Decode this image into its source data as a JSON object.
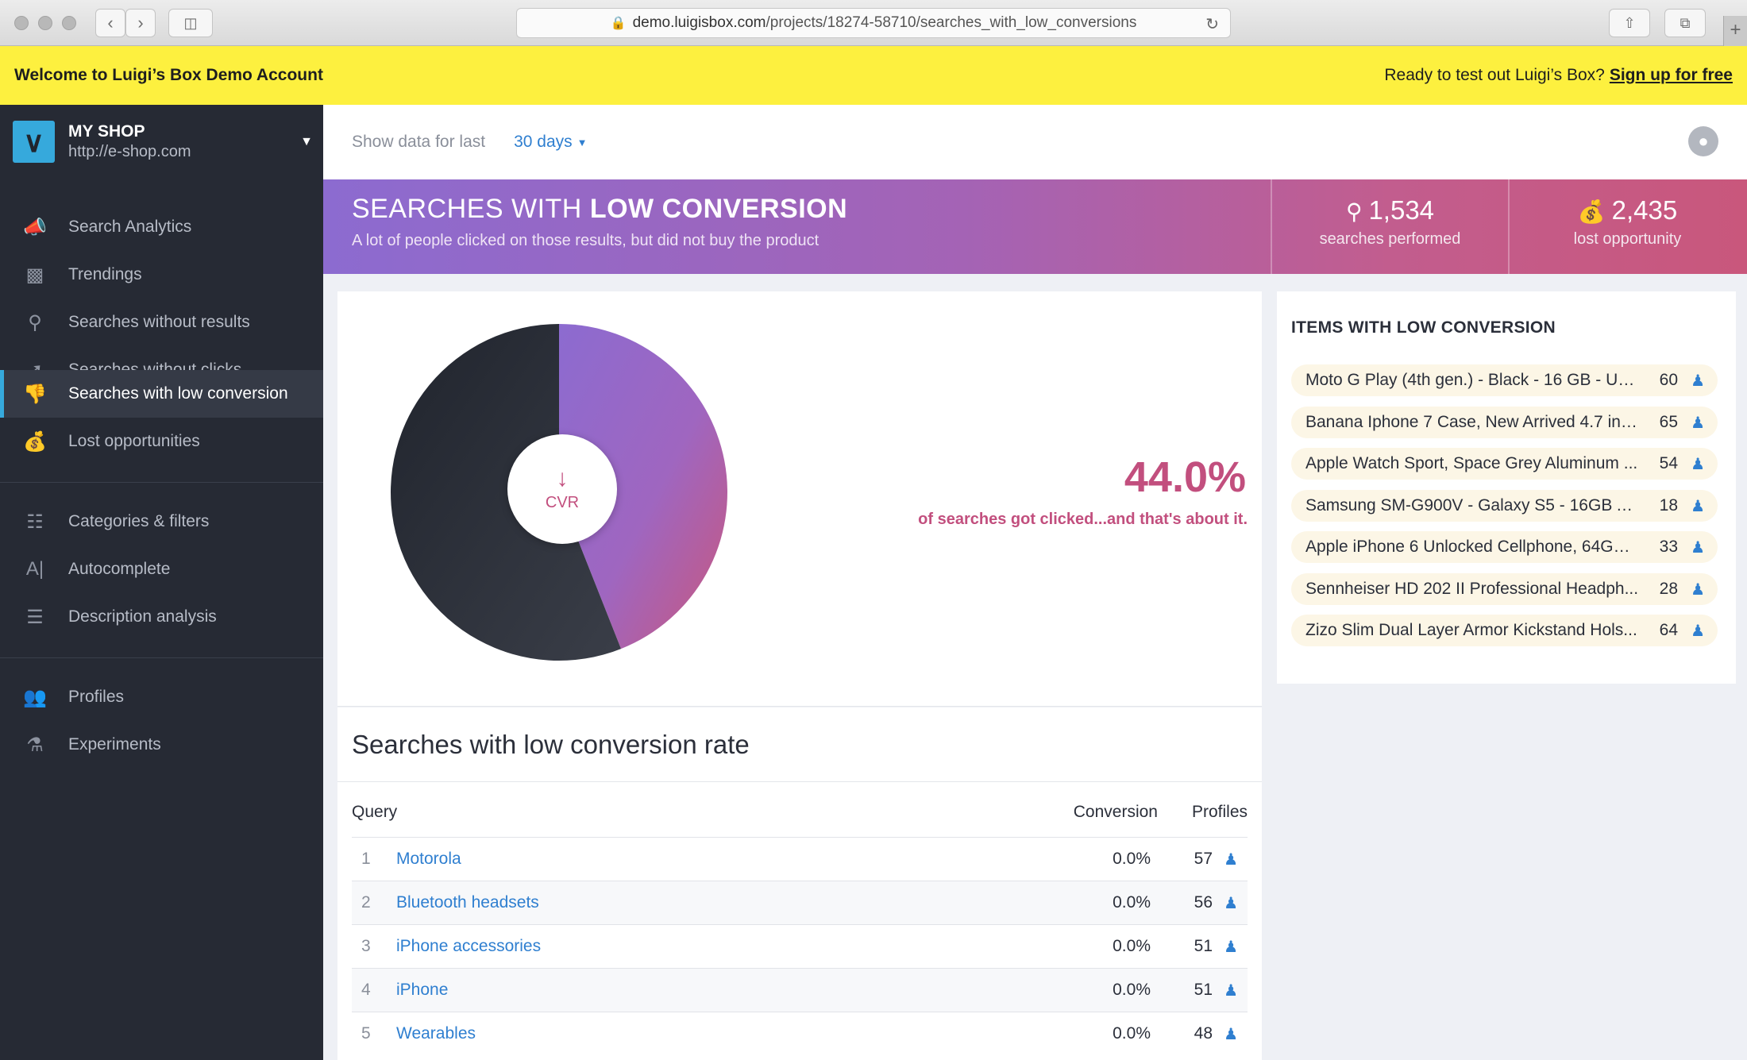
{
  "browser": {
    "url_host": "demo.luigisbox.com",
    "url_path": "/projects/18274-58710/searches_with_low_conversions"
  },
  "banner": {
    "welcome": "Welcome to Luigi’s Box Demo Account",
    "cta_prefix": "Ready to test out Luigi’s Box?",
    "cta_link": "Sign up for free"
  },
  "shop": {
    "name": "MY SHOP",
    "url": "http://e-shop.com"
  },
  "sidebar": {
    "items": [
      {
        "label": "Search Analytics",
        "icon": "megaphone-icon"
      },
      {
        "label": "Trendings",
        "icon": "bar-chart-icon"
      },
      {
        "label": "Searches without results",
        "icon": "search-x-icon"
      },
      {
        "label": "Searches without clicks",
        "icon": "cursor-icon"
      },
      {
        "label": "Searches with low conversion",
        "icon": "thumbs-down-icon",
        "active": true
      },
      {
        "label": "Lost opportunities",
        "icon": "money-bag-icon"
      },
      {
        "label": "Categories & filters",
        "icon": "sliders-icon"
      },
      {
        "label": "Autocomplete",
        "icon": "text-cursor-icon"
      },
      {
        "label": "Description analysis",
        "icon": "lines-icon"
      },
      {
        "label": "Profiles",
        "icon": "users-icon"
      },
      {
        "label": "Experiments",
        "icon": "flask-icon"
      }
    ]
  },
  "topbar": {
    "label": "Show data for last",
    "range": "30 days"
  },
  "hero": {
    "title_light": "SEARCHES WITH ",
    "title_bold": "LOW CONVERSION",
    "subtitle": "A lot of people clicked on those results, but did not buy the product",
    "stats": [
      {
        "value": "1,534",
        "caption": "searches performed",
        "icon": "search-icon"
      },
      {
        "value": "2,435",
        "caption": "lost opportunity",
        "icon": "money-bag-icon"
      }
    ]
  },
  "chart_data": {
    "type": "pie",
    "categories": [
      "clicked",
      "not clicked"
    ],
    "values": [
      44.0,
      56.0
    ],
    "center_label": "CVR",
    "colors": [
      "#8c6bd0",
      "#262a34"
    ]
  },
  "summary": {
    "percent": "44.0%",
    "note": "of searches got clicked...and that's about it."
  },
  "table": {
    "title": "Searches with low conversion rate",
    "columns": [
      "Query",
      "Conversion",
      "Profiles"
    ],
    "rows": [
      {
        "idx": "1",
        "query": "Motorola",
        "conversion": "0.0%",
        "profiles": "57"
      },
      {
        "idx": "2",
        "query": "Bluetooth headsets",
        "conversion": "0.0%",
        "profiles": "56"
      },
      {
        "idx": "3",
        "query": "iPhone accessories",
        "conversion": "0.0%",
        "profiles": "51"
      },
      {
        "idx": "4",
        "query": "iPhone",
        "conversion": "0.0%",
        "profiles": "51"
      },
      {
        "idx": "5",
        "query": "Wearables",
        "conversion": "0.0%",
        "profiles": "48"
      }
    ]
  },
  "items": {
    "title": "ITEMS WITH LOW CONVERSION",
    "list": [
      {
        "name": "Moto G Play (4th gen.) - Black - 16 GB - Un...",
        "count": "60"
      },
      {
        "name": "Banana Iphone 7 Case, New Arrived 4.7 inc...",
        "count": "65"
      },
      {
        "name": "Apple Watch Sport, Space Grey Aluminum ...",
        "count": "54"
      },
      {
        "name": "Samsung SM-G900V - Galaxy S5 - 16GB A...",
        "count": "18"
      },
      {
        "name": "Apple iPhone 6 Unlocked Cellphone, 64GB,...",
        "count": "33"
      },
      {
        "name": "Sennheiser HD 202 II Professional Headph...",
        "count": "28"
      },
      {
        "name": "Zizo Slim Dual Layer Armor Kickstand Hols...",
        "count": "64"
      }
    ]
  }
}
